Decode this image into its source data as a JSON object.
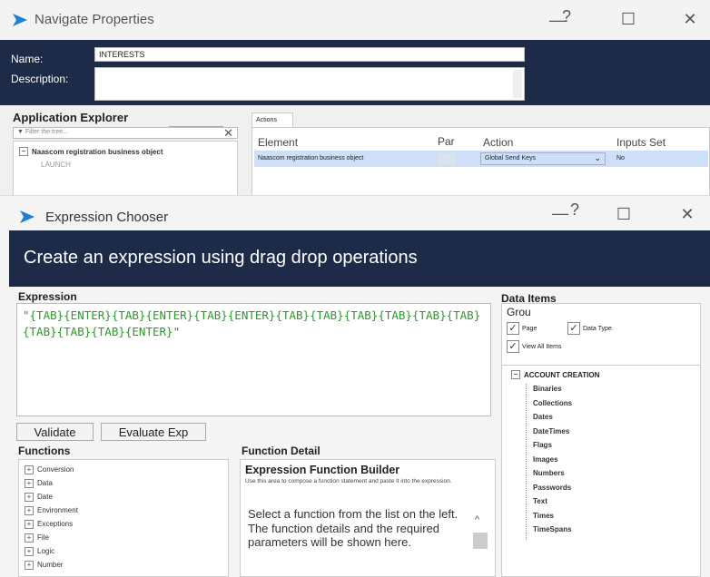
{
  "navigate_window": {
    "title": "Navigate Properties",
    "controls": {
      "help": "?",
      "minimize": "—",
      "maximize": "☐",
      "close": "✕"
    },
    "name_label": "Name:",
    "name_value": "INTERESTS",
    "description_label": "Description:"
  },
  "app_explorer": {
    "title": "Application Explorer",
    "filter_placeholder": "Filter the tree...",
    "clear_icon": "✕",
    "tree": [
      "Naascom registration business object",
      "LAUNCH"
    ]
  },
  "actions": {
    "tab_label": "Actions",
    "columns": [
      "Element",
      "Par",
      "Action",
      "Inputs Set"
    ],
    "row": {
      "element": "Naascom registration business object",
      "par": "",
      "action": "Global Send Keys",
      "inputs_set": "No"
    }
  },
  "expression_chooser": {
    "title": "Expression Chooser",
    "controls": {
      "help": "?",
      "minimize": "—",
      "maximize": "☐",
      "close": "✕"
    },
    "banner": "Create an expression using drag drop operations",
    "expression_label": "Expression",
    "expression_text": "\"{TAB}{ENTER}{TAB}{ENTER}{TAB}{ENTER}{TAB}{TAB}{TAB}{TAB}{TAB}{TAB}{TAB}{TAB}{TAB}{ENTER}\"",
    "validate_label": "Validate",
    "evaluate_label": "Evaluate Exp",
    "functions_label": "Functions",
    "functions": [
      "Conversion",
      "Data",
      "Date",
      "Environment",
      "Exceptions",
      "File",
      "Logic",
      "Number"
    ],
    "function_detail_label": "Function Detail",
    "builder_title": "Expression Function Builder",
    "builder_desc": "Use this area to compose a function statement and paste it into the expression.",
    "builder_body": "Select a function from the list on the left. The function details and the required parameters will be shown here.",
    "data_items_label": "Data Items",
    "group_label": "Grou",
    "checkboxes": [
      {
        "label": "Page",
        "checked": true
      },
      {
        "label": "Data Type",
        "checked": true
      },
      {
        "label": "View All Items",
        "checked": true
      }
    ],
    "data_root": "ACCOUNT CREATION",
    "data_items": [
      "Binaries",
      "Collections",
      "Dates",
      "DateTimes",
      "Flags",
      "Images",
      "Numbers",
      "Passwords",
      "Text",
      "Times",
      "TimeSpans"
    ]
  },
  "colors": {
    "navy": "#1d2b48",
    "expression_green": "#2a9a2a",
    "selection_blue": "#cde0f7",
    "icon_blue": "#1f7fd0"
  }
}
